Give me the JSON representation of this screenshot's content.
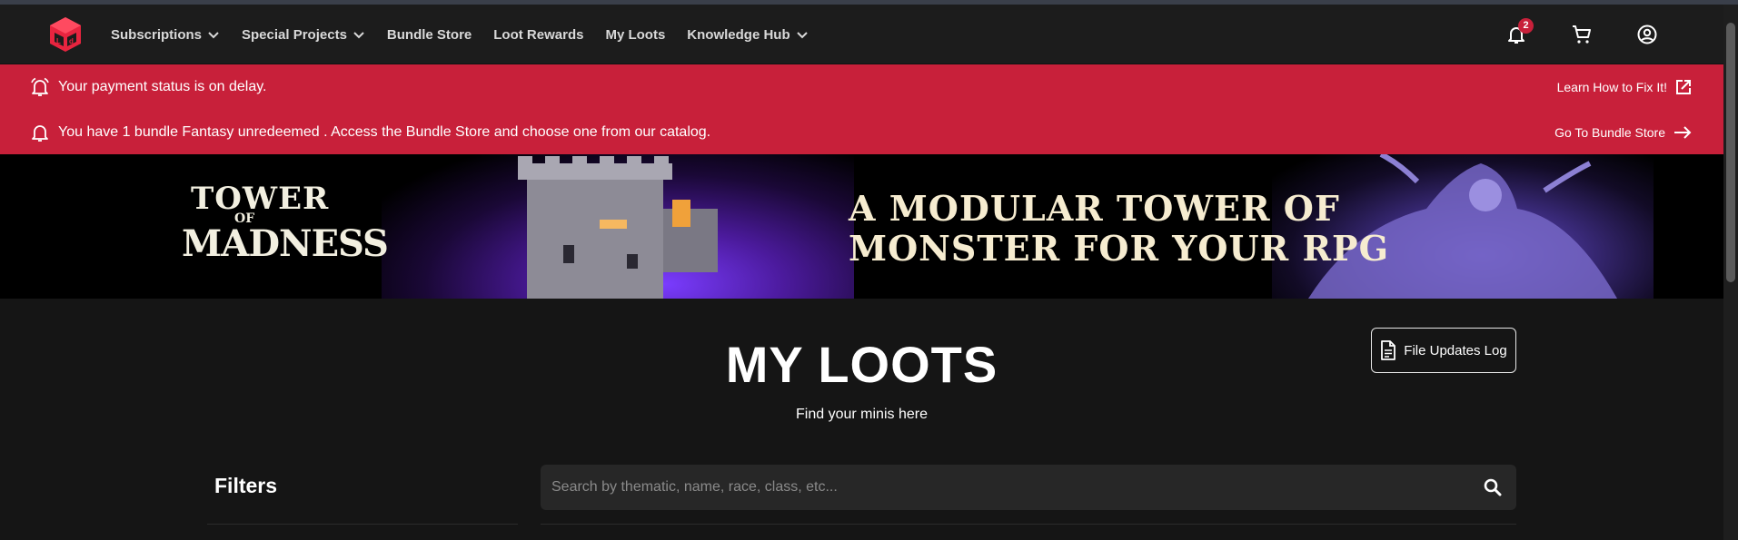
{
  "nav": {
    "items": [
      {
        "label": "Subscriptions",
        "dropdown": true
      },
      {
        "label": "Special Projects",
        "dropdown": true
      },
      {
        "label": "Bundle Store",
        "dropdown": false
      },
      {
        "label": "Loot Rewards",
        "dropdown": false
      },
      {
        "label": "My Loots",
        "dropdown": false
      },
      {
        "label": "Knowledge Hub",
        "dropdown": true
      }
    ],
    "notification_count": "2",
    "icons": [
      "notification-bell-icon",
      "cart-icon",
      "account-icon"
    ]
  },
  "alerts": [
    {
      "message": "Your payment status is on delay.",
      "action": "Learn How to Fix It!",
      "action_icon": "external-link-icon"
    },
    {
      "message": "You have 1 bundle Fantasy unredeemed . Access the Bundle Store and choose one from our catalog.",
      "action": "Go To Bundle Store",
      "action_icon": "arrow-right-icon"
    }
  ],
  "banner": {
    "logo_line1": "TOWER",
    "logo_line2": "OF",
    "logo_line3": "MADNESS",
    "headline_line1": "A MODULAR TOWER OF",
    "headline_line2": "MONSTER FOR YOUR RPG"
  },
  "page": {
    "title": "MY LOOTS",
    "subtitle": "Find your minis here",
    "file_updates_label": "File Updates Log",
    "filters_label": "Filters"
  },
  "search": {
    "placeholder": "Search by thematic, name, race, class, etc..."
  },
  "colors": {
    "accent": "#c8203a",
    "background": "#151515",
    "navbar": "#1c1c1c"
  }
}
